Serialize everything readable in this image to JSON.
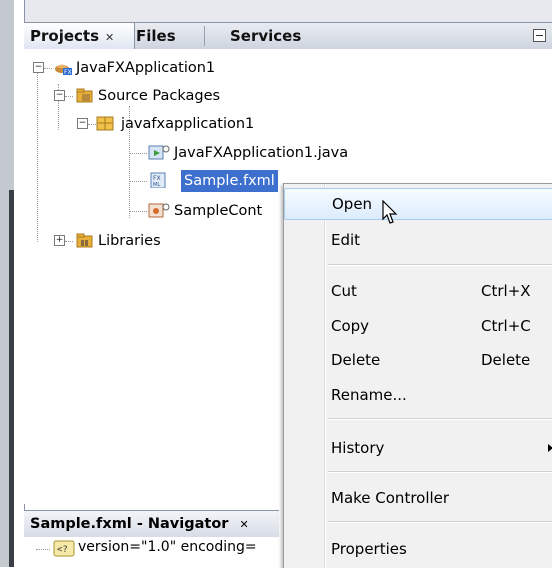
{
  "tabs": [
    {
      "label": "Projects",
      "close_glyph": "✕",
      "active": true
    },
    {
      "label": "Files",
      "active": false
    },
    {
      "label": "Services",
      "active": false
    }
  ],
  "tree": {
    "project": "JavaFXApplication1",
    "source_packages": "Source Packages",
    "package": "javafxapplication1",
    "files": [
      "JavaFXApplication1.java",
      "Sample.fxml",
      "SampleCont"
    ],
    "selected_file": "Sample.fxml",
    "libraries": "Libraries"
  },
  "navigator": {
    "title": "Sample.fxml - Navigator",
    "close_glyph": "✕",
    "row": "version=\"1.0\" encoding="
  },
  "menu": {
    "items": [
      {
        "label": "Open",
        "shortcut": "",
        "highlighted": true
      },
      {
        "label": "Edit",
        "shortcut": ""
      },
      {
        "label": "Cut",
        "shortcut": "Ctrl+X"
      },
      {
        "label": "Copy",
        "shortcut": "Ctrl+C"
      },
      {
        "label": "Delete",
        "shortcut": "Delete"
      },
      {
        "label": "Rename...",
        "shortcut": ""
      },
      {
        "label": "History",
        "shortcut": "",
        "submenu": true
      },
      {
        "label": "Make Controller",
        "shortcut": ""
      },
      {
        "label": "Properties",
        "shortcut": ""
      }
    ]
  },
  "colors": {
    "selection": "#3d6fcf",
    "menu_highlight": "#dcecfc",
    "menu_bg": "#f1f1f1"
  }
}
